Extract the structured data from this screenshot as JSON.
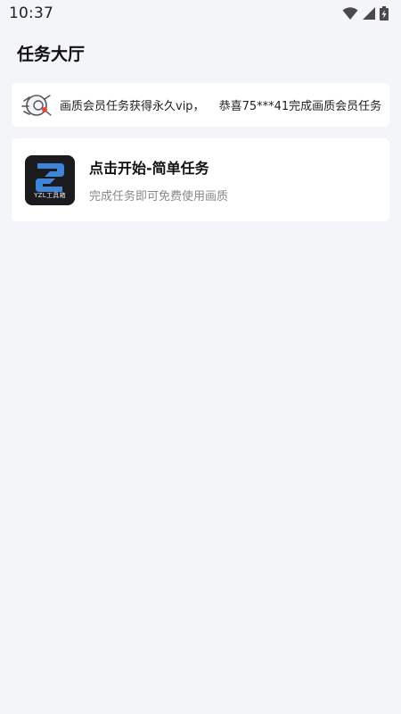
{
  "status_bar": {
    "time": "10:37",
    "icons": [
      "wifi-icon",
      "signal-icon",
      "battery-charging-icon"
    ]
  },
  "page": {
    "title": "任务大厅"
  },
  "notice": {
    "icon": "megaphone-icon",
    "text_left": "画质会员任务获得永久vip，",
    "text_right": "恭喜75***41完成画质会员任务"
  },
  "task": {
    "logo_text": "YZL工具箱",
    "title": "点击开始-简单任务",
    "description": "完成任务即可免费使用画质"
  },
  "colors": {
    "background": "#f4f5f9",
    "card": "#ffffff",
    "logo_bg": "#1b1b1f",
    "logo_accent": "#3f86d8",
    "muted_text": "#888888"
  }
}
